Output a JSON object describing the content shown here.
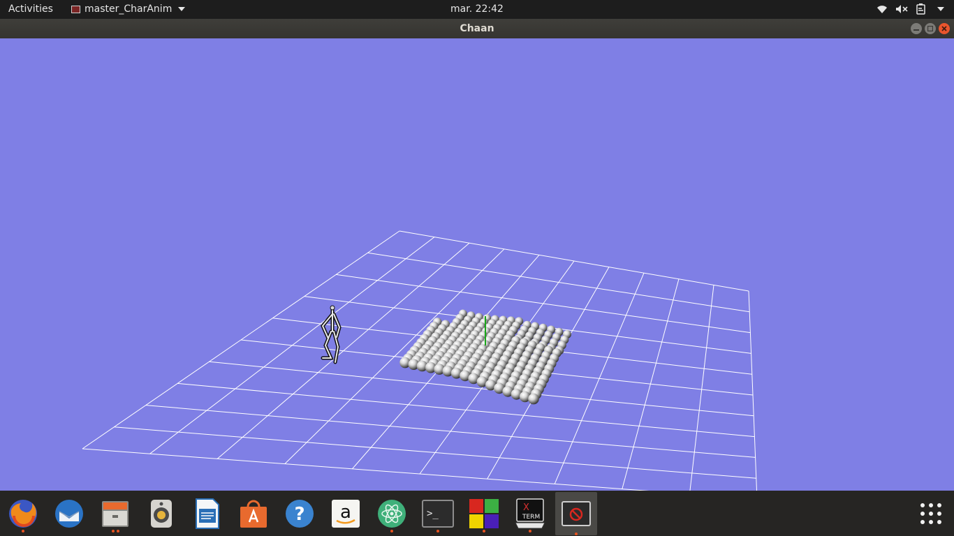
{
  "topbar": {
    "activities": "Activities",
    "app_name": "master_CharAnim",
    "clock": "mar. 22:42"
  },
  "window": {
    "title": "Chaan"
  },
  "scene": {
    "background_color": "#7f7fe5",
    "grid_color": "#ffffff",
    "objects": [
      "grid-floor",
      "skeleton-figure",
      "sphere-cloth",
      "green-axis"
    ]
  },
  "dock": {
    "items": [
      {
        "name": "firefox-icon",
        "running": 1
      },
      {
        "name": "thunderbird-icon",
        "running": 0
      },
      {
        "name": "files-icon",
        "running": 2
      },
      {
        "name": "rhythmbox-icon",
        "running": 0
      },
      {
        "name": "libreoffice-writer-icon",
        "running": 0
      },
      {
        "name": "software-center-icon",
        "running": 0
      },
      {
        "name": "help-icon",
        "running": 0
      },
      {
        "name": "amazon-icon",
        "running": 0
      },
      {
        "name": "atom-icon",
        "running": 1
      },
      {
        "name": "terminal-icon",
        "running": 1
      },
      {
        "name": "windows-app-icon",
        "running": 1
      },
      {
        "name": "xterm-icon",
        "running": 1
      },
      {
        "name": "chaan-window-icon",
        "running": 1,
        "active": true
      }
    ],
    "xterm_label_x": "X",
    "xterm_label_term": "TERM",
    "amazon_label": "a",
    "help_label": "?",
    "terminal_label": ">_"
  }
}
